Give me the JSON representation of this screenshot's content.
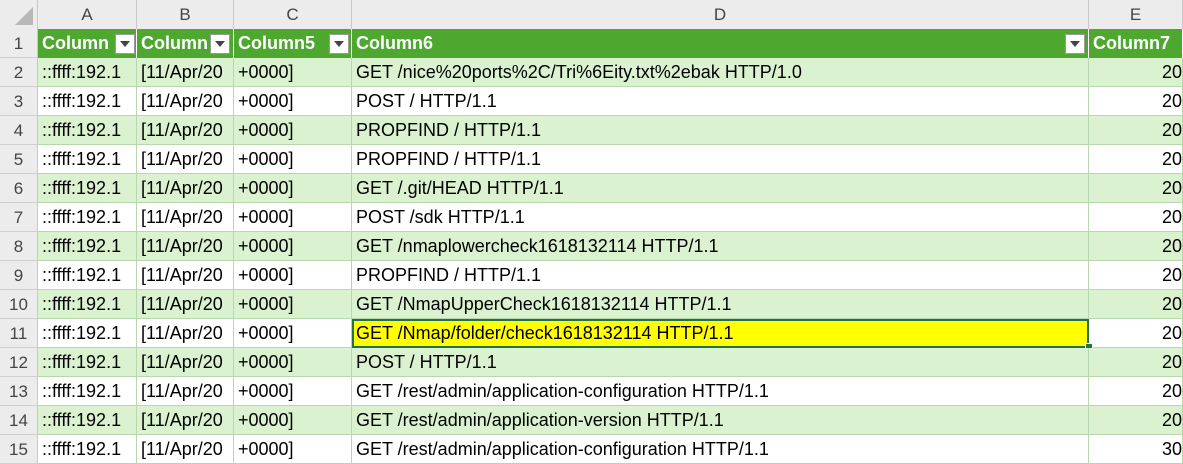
{
  "columns": [
    "A",
    "B",
    "C",
    "D",
    "E"
  ],
  "header": {
    "row_number": "1",
    "a": "Column",
    "b": "Column",
    "c": "Column5",
    "d": "Column6",
    "e": "Column7"
  },
  "rows": [
    {
      "n": "2",
      "a": "::ffff:192.1",
      "b": "[11/Apr/20",
      "c": "+0000]",
      "d": "GET /nice%20ports%2C/Tri%6Eity.txt%2ebak HTTP/1.0",
      "e": "20"
    },
    {
      "n": "3",
      "a": "::ffff:192.1",
      "b": "[11/Apr/20",
      "c": "+0000]",
      "d": "POST / HTTP/1.1",
      "e": "20"
    },
    {
      "n": "4",
      "a": "::ffff:192.1",
      "b": "[11/Apr/20",
      "c": "+0000]",
      "d": "PROPFIND / HTTP/1.1",
      "e": "20"
    },
    {
      "n": "5",
      "a": "::ffff:192.1",
      "b": "[11/Apr/20",
      "c": "+0000]",
      "d": "PROPFIND / HTTP/1.1",
      "e": "20"
    },
    {
      "n": "6",
      "a": "::ffff:192.1",
      "b": "[11/Apr/20",
      "c": "+0000]",
      "d": "GET /.git/HEAD HTTP/1.1",
      "e": "20"
    },
    {
      "n": "7",
      "a": "::ffff:192.1",
      "b": "[11/Apr/20",
      "c": "+0000]",
      "d": "POST /sdk HTTP/1.1",
      "e": "20"
    },
    {
      "n": "8",
      "a": "::ffff:192.1",
      "b": "[11/Apr/20",
      "c": "+0000]",
      "d": "GET /nmaplowercheck1618132114 HTTP/1.1",
      "e": "20"
    },
    {
      "n": "9",
      "a": "::ffff:192.1",
      "b": "[11/Apr/20",
      "c": "+0000]",
      "d": "PROPFIND / HTTP/1.1",
      "e": "20"
    },
    {
      "n": "10",
      "a": "::ffff:192.1",
      "b": "[11/Apr/20",
      "c": "+0000]",
      "d": "GET /NmapUpperCheck1618132114 HTTP/1.1",
      "e": "20"
    },
    {
      "n": "11",
      "a": "::ffff:192.1",
      "b": "[11/Apr/20",
      "c": "+0000]",
      "d": "GET /Nmap/folder/check1618132114 HTTP/1.1",
      "e": "20"
    },
    {
      "n": "12",
      "a": "::ffff:192.1",
      "b": "[11/Apr/20",
      "c": "+0000]",
      "d": "POST / HTTP/1.1",
      "e": "20"
    },
    {
      "n": "13",
      "a": "::ffff:192.1",
      "b": "[11/Apr/20",
      "c": "+0000]",
      "d": "GET /rest/admin/application-configuration HTTP/1.1",
      "e": "20"
    },
    {
      "n": "14",
      "a": "::ffff:192.1",
      "b": "[11/Apr/20",
      "c": "+0000]",
      "d": "GET /rest/admin/application-version HTTP/1.1",
      "e": "20"
    },
    {
      "n": "15",
      "a": "::ffff:192.1",
      "b": "[11/Apr/20",
      "c": "+0000]",
      "d": "GET /rest/admin/application-configuration HTTP/1.1",
      "e": "30"
    }
  ],
  "selected_row": "11",
  "colors": {
    "table_header": "#4ea72e",
    "band": "#daf2d0",
    "selection_fill": "#ffff00",
    "selection_border": "#217346"
  }
}
